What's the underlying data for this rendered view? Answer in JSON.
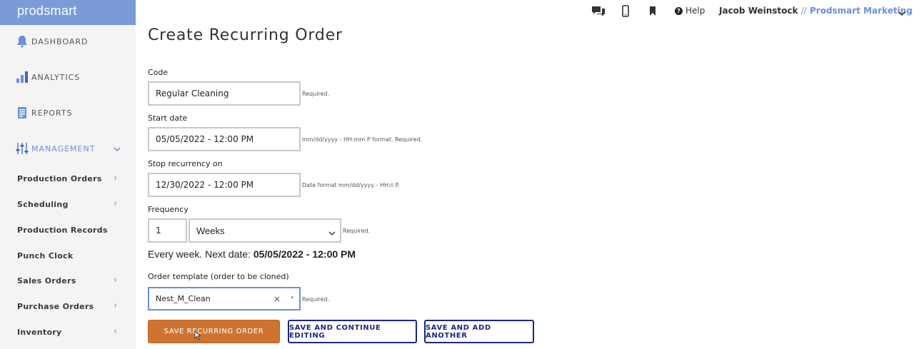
{
  "app": {
    "brand": "prodsmart"
  },
  "sidebar": {
    "main_items": [
      {
        "label": "DASHBOARD",
        "icon": "bell-icon"
      },
      {
        "label": "ANALYTICS",
        "icon": "bar-chart-icon"
      },
      {
        "label": "REPORTS",
        "icon": "document-icon"
      },
      {
        "label": "MANAGEMENT",
        "icon": "sliders-icon",
        "active": true
      }
    ],
    "sub_items": [
      {
        "label": "Production Orders",
        "has_arrow": true
      },
      {
        "label": "Scheduling",
        "has_arrow": true
      },
      {
        "label": "Production Records",
        "has_arrow": false
      },
      {
        "label": "Punch Clock",
        "has_arrow": false
      },
      {
        "label": "Sales Orders",
        "has_arrow": true
      },
      {
        "label": "Purchase Orders",
        "has_arrow": true
      },
      {
        "label": "Inventory",
        "has_arrow": true
      }
    ],
    "arrow_glyph": "‹",
    "active_color": "#6c8fd9"
  },
  "topbar": {
    "help_label": "Help",
    "help_glyph": "?",
    "user_name": "Jacob Weinstock",
    "separator": "//",
    "org_name": "Prodsmart Marketing"
  },
  "form": {
    "title": "Create Recurring Order",
    "code": {
      "label": "Code",
      "value": "Regular Cleaning",
      "hint": "Required."
    },
    "start_date": {
      "label": "Start date",
      "value": "05/05/2022 - 12:00 PM",
      "hint": "mm/dd/yyyy - HH:mm P format. Required."
    },
    "stop_recurrency": {
      "label": "Stop recurrency on",
      "value": "12/30/2022 - 12:00 PM",
      "hint": "Date format mm/dd/yyyy - HH:ii P."
    },
    "frequency": {
      "label": "Frequency",
      "count": "1",
      "unit": "Weeks",
      "hint": "Required."
    },
    "summary": {
      "prefix": "Every week. Next date:",
      "next_date": "05/05/2022 - 12:00 PM"
    },
    "template": {
      "label": "Order template (order to be cloned)",
      "value": "Nest_M_Clean",
      "clear_glyph": "×",
      "caret_glyph": "▾",
      "hint": "Required."
    }
  },
  "buttons": {
    "save": "SAVE RECURRING ORDER",
    "save_continue": "SAVE AND CONTINUE EDITING",
    "save_add": "SAVE AND ADD ANOTHER"
  },
  "colors": {
    "accent": "#6c8fd9",
    "primary_button": "#cf7430",
    "outline_button": "#1d2780"
  }
}
